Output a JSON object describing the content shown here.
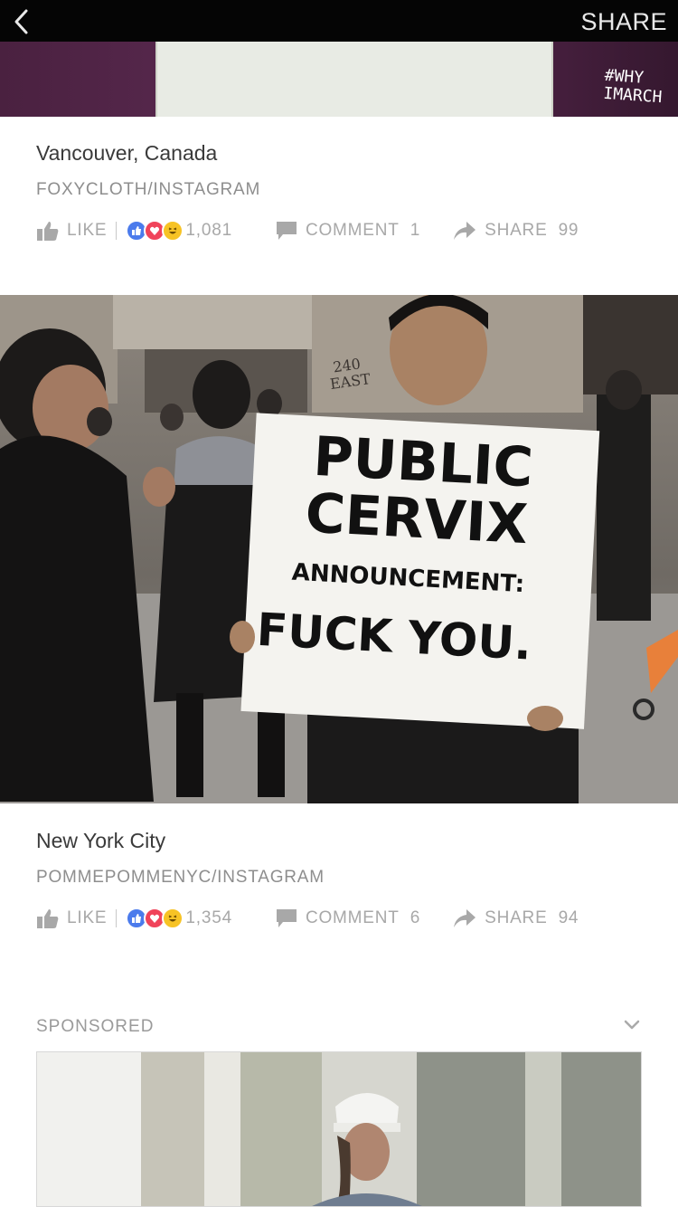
{
  "topbar": {
    "back_icon": "chevron-left-icon",
    "share_label": "SHARE"
  },
  "story1": {
    "photo_hashtag_line1": "#WHY",
    "photo_hashtag_line2": "IMARCH",
    "location": "Vancouver, Canada",
    "credit": "FOXYCLOTH/INSTAGRAM",
    "like_label": "LIKE",
    "reaction_count": "1,081",
    "comment_label": "COMMENT",
    "comment_count": "1",
    "share_label": "SHARE",
    "share_count": "99"
  },
  "story2": {
    "sign_line1": "PUBLIC",
    "sign_line2": "CERVIX",
    "sign_line3": "ANNOUNCEMENT:",
    "sign_line4": "FUCK YOU.",
    "building_number": "240",
    "building_street": "EAST",
    "location": "New York City",
    "credit": "POMMEPOMMENYC/INSTAGRAM",
    "like_label": "LIKE",
    "reaction_count": "1,354",
    "comment_label": "COMMENT",
    "comment_count": "6",
    "share_label": "SHARE",
    "share_count": "94"
  },
  "sponsored": {
    "label": "SPONSORED",
    "menu_icon": "chevron-down-icon"
  },
  "colors": {
    "topbar_bg": "#050505",
    "like_reaction": "#4b7bec",
    "love_reaction": "#f0435a",
    "haha_reaction": "#f7c325",
    "action_text": "#a8a8a8"
  }
}
